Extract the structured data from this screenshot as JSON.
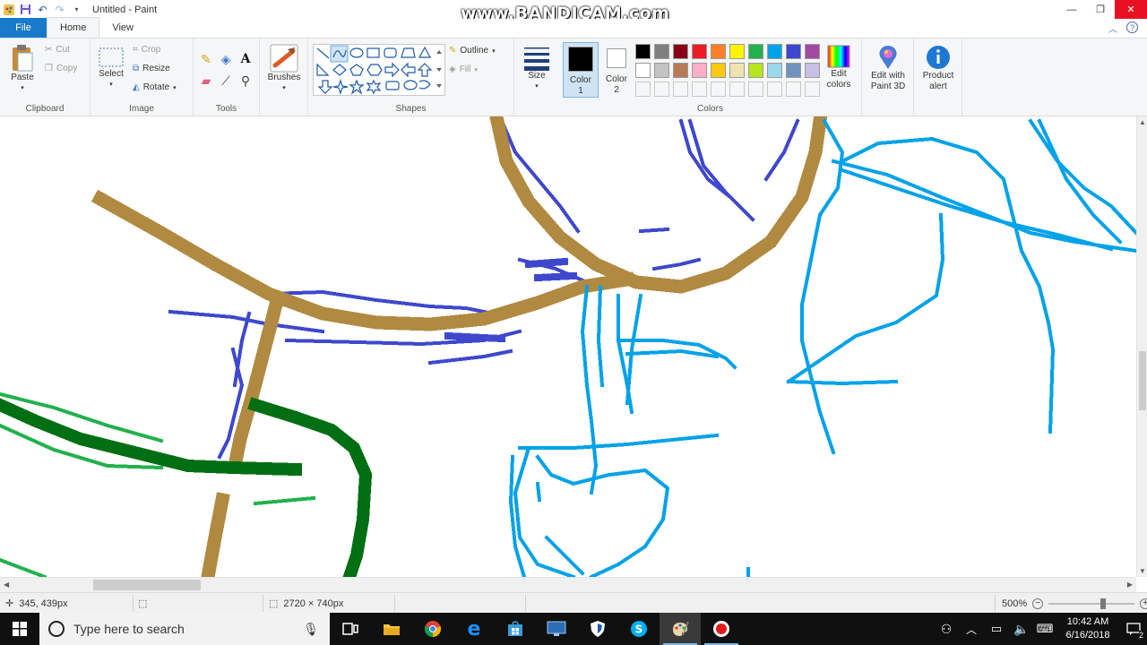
{
  "window": {
    "title": "Untitled - Paint",
    "watermark": "www.BANDICAM.com",
    "controls": [
      "minimize-icon",
      "restore-icon",
      "close-icon"
    ]
  },
  "tabs": {
    "file": "File",
    "home": "Home",
    "view": "View"
  },
  "ribbon": {
    "clipboard": {
      "label": "Clipboard",
      "paste": "Paste",
      "cut": "Cut",
      "copy": "Copy"
    },
    "image": {
      "label": "Image",
      "select": "Select",
      "crop": "Crop",
      "resize": "Resize",
      "rotate": "Rotate"
    },
    "tools": {
      "label": "Tools",
      "items": [
        "pencil-icon",
        "fill-icon",
        "text-icon",
        "eraser-icon",
        "color-picker-icon",
        "magnifier-icon"
      ]
    },
    "brushes": {
      "label": "Brushes"
    },
    "shapes": {
      "label": "Shapes",
      "outline": "Outline",
      "fill": "Fill"
    },
    "size": {
      "label": "Size"
    },
    "colors": {
      "label": "Colors",
      "color1": {
        "label": "Color",
        "num": "1",
        "value": "#000000"
      },
      "color2": {
        "label": "Color",
        "num": "2",
        "value": "#ffffff"
      },
      "row1": [
        "#000000",
        "#7f7f7f",
        "#880015",
        "#ed1c24",
        "#ff7f27",
        "#fff200",
        "#22b14c",
        "#00a2e8",
        "#3f48cc",
        "#a349a4"
      ],
      "row2": [
        "#ffffff",
        "#c3c3c3",
        "#b97a57",
        "#ffaec9",
        "#ffc90e",
        "#efe4b0",
        "#b5e61d",
        "#99d9ea",
        "#7092be",
        "#c8bfe7"
      ],
      "edit_colors_line1": "Edit",
      "edit_colors_line2": "colors"
    },
    "paint3d": {
      "line1": "Edit with",
      "line2": "Paint 3D"
    },
    "product_alert": {
      "line1": "Product",
      "line2": "alert"
    }
  },
  "status": {
    "cursor_pos": "345, 439px",
    "canvas_size": "2720 × 740px",
    "zoom": "500%"
  },
  "taskbar": {
    "search_placeholder": "Type here to search",
    "time": "10:42 AM",
    "date": "6/16/2018",
    "notification_count": "2",
    "apps": [
      "task-view-icon",
      "file-explorer-icon",
      "chrome-icon",
      "edge-icon",
      "store-icon",
      "remote-desktop-icon",
      "security-icon",
      "skype-icon",
      "paint-icon",
      "bandicam-icon"
    ]
  }
}
